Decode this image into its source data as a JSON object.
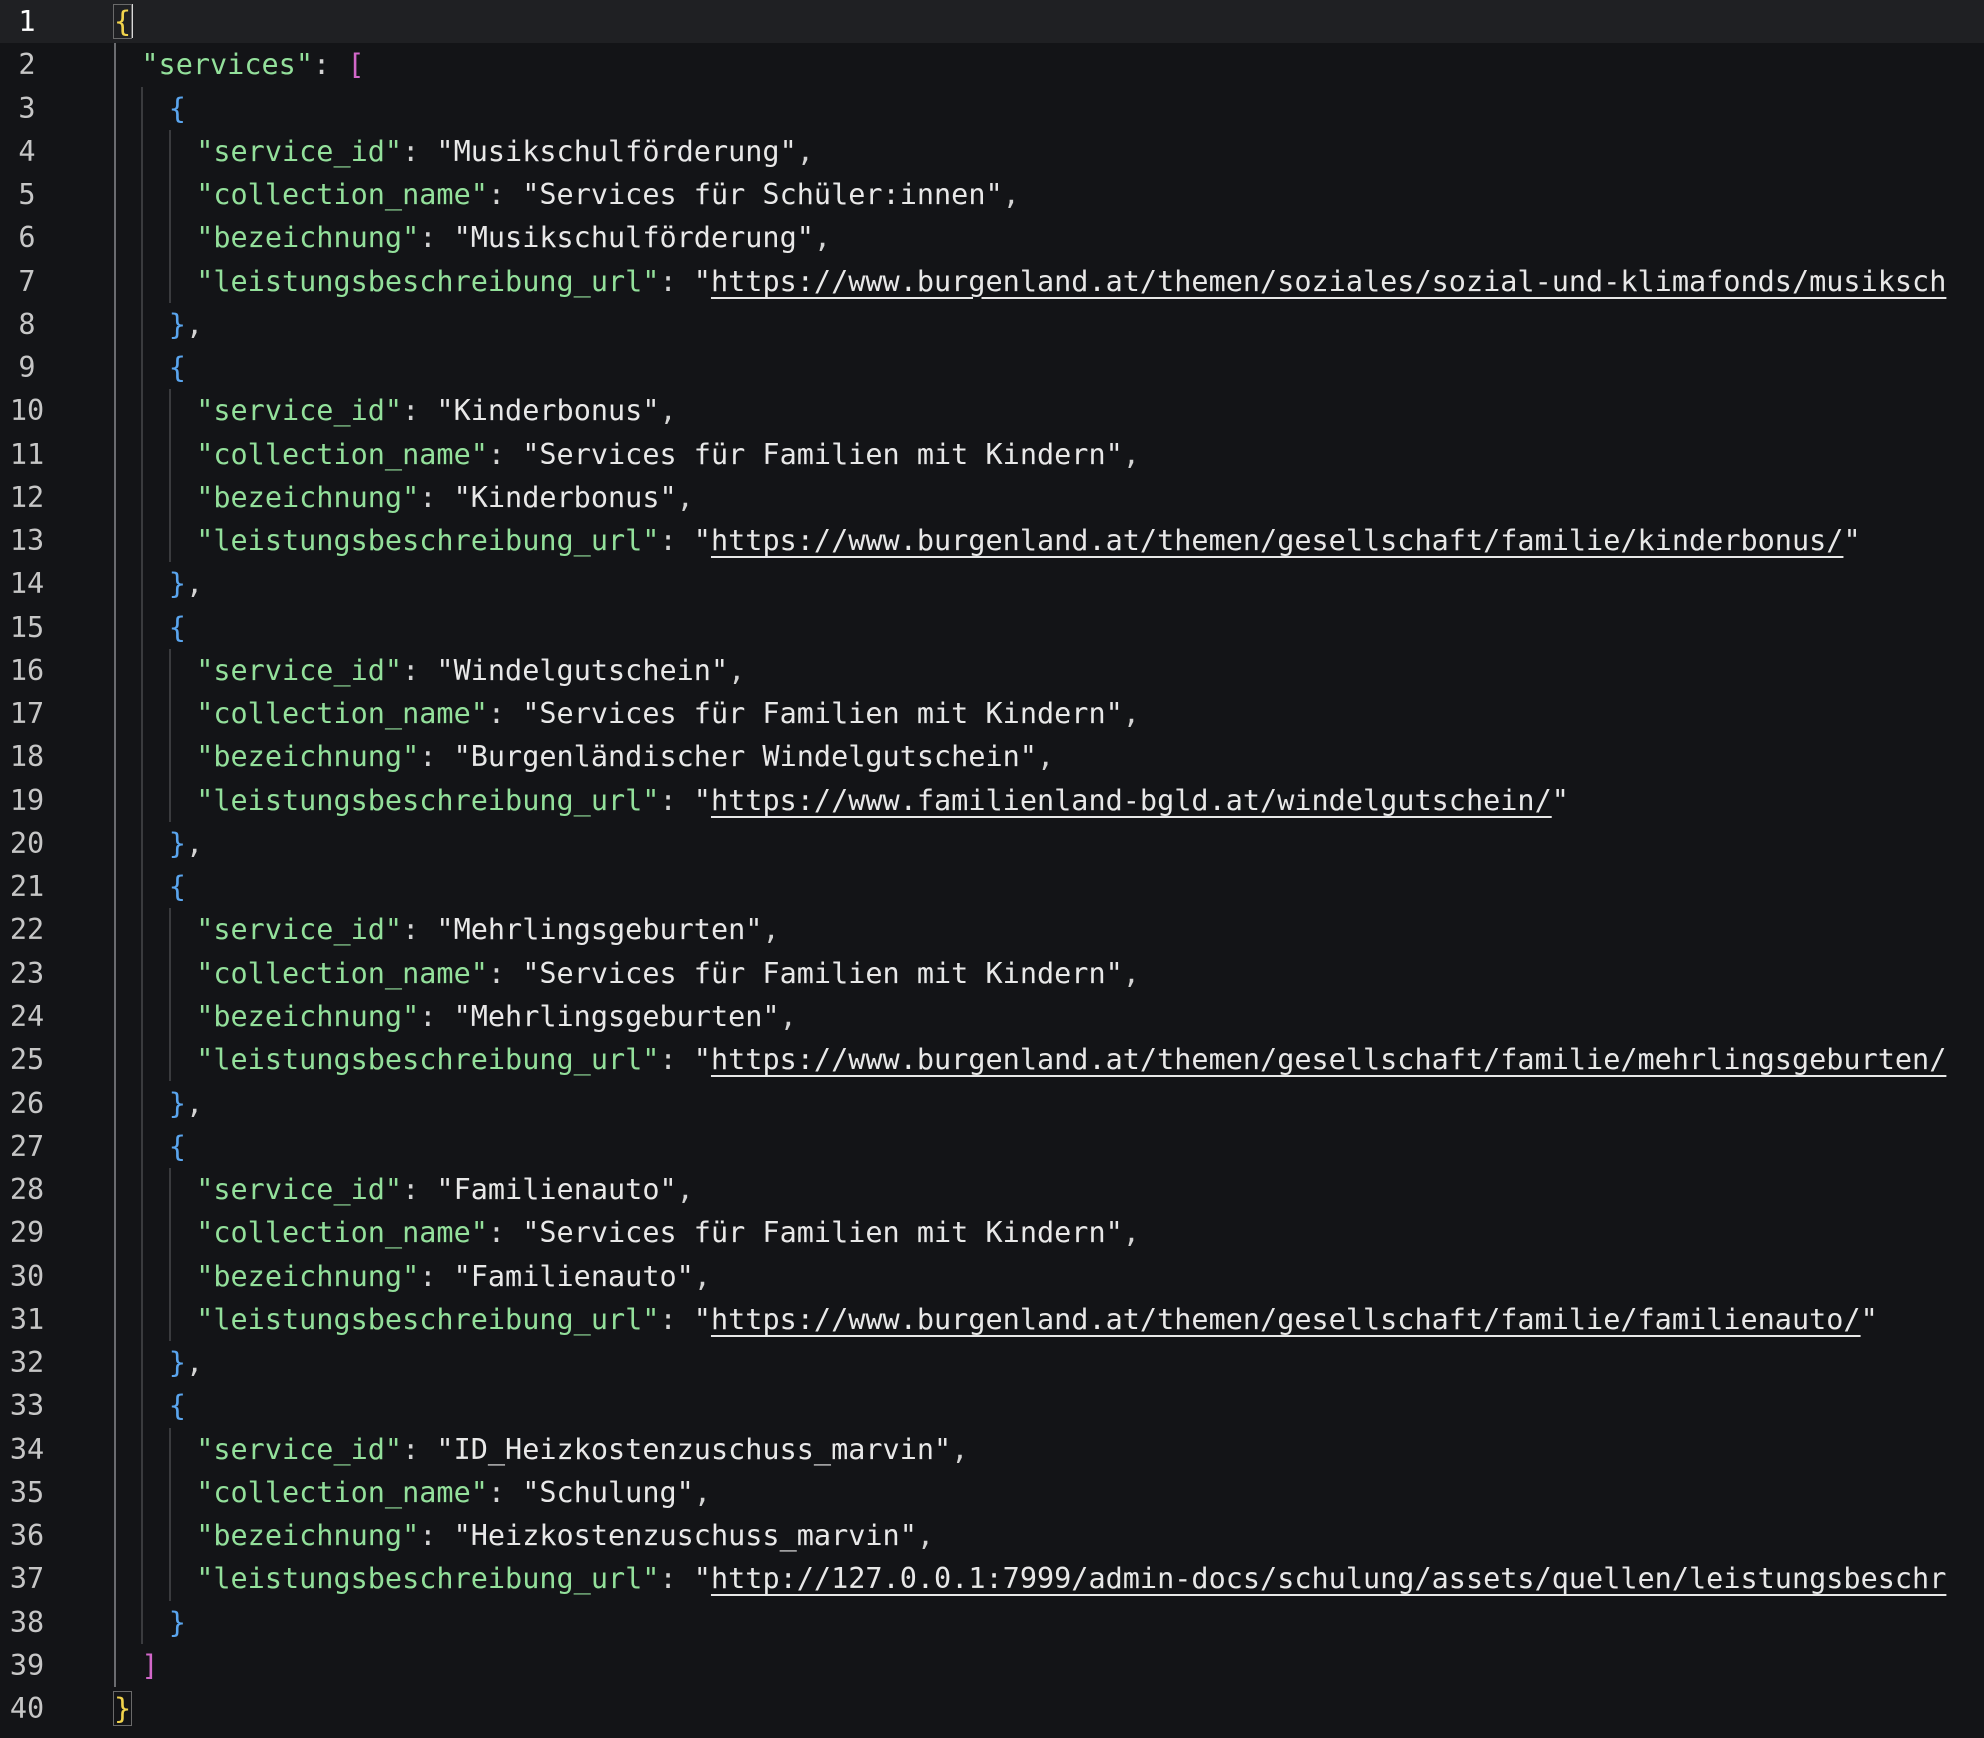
{
  "editor": {
    "language": "json",
    "cursor": {
      "line": 1,
      "column": 2
    },
    "lines": [
      {
        "n": "1",
        "indent": 0,
        "tokens": [
          {
            "t": "{",
            "c": "b1"
          }
        ]
      },
      {
        "n": "2",
        "indent": 1,
        "tokens": [
          {
            "t": "\"services\"",
            "c": "key"
          },
          {
            "t": ": ",
            "c": "punc"
          },
          {
            "t": "[",
            "c": "b2"
          }
        ]
      },
      {
        "n": "3",
        "indent": 2,
        "tokens": [
          {
            "t": "{",
            "c": "b3"
          }
        ]
      },
      {
        "n": "4",
        "indent": 3,
        "tokens": [
          {
            "t": "\"service_id\"",
            "c": "key"
          },
          {
            "t": ": ",
            "c": "punc"
          },
          {
            "t": "\"Musikschulförderung\"",
            "c": "str"
          },
          {
            "t": ",",
            "c": "punc"
          }
        ]
      },
      {
        "n": "5",
        "indent": 3,
        "tokens": [
          {
            "t": "\"collection_name\"",
            "c": "key"
          },
          {
            "t": ": ",
            "c": "punc"
          },
          {
            "t": "\"Services für Schüler:innen\"",
            "c": "str"
          },
          {
            "t": ",",
            "c": "punc"
          }
        ]
      },
      {
        "n": "6",
        "indent": 3,
        "tokens": [
          {
            "t": "\"bezeichnung\"",
            "c": "key"
          },
          {
            "t": ": ",
            "c": "punc"
          },
          {
            "t": "\"Musikschulförderung\"",
            "c": "str"
          },
          {
            "t": ",",
            "c": "punc"
          }
        ]
      },
      {
        "n": "7",
        "indent": 3,
        "tokens": [
          {
            "t": "\"leistungsbeschreibung_url\"",
            "c": "key"
          },
          {
            "t": ": ",
            "c": "punc"
          },
          {
            "t": "\"",
            "c": "str"
          },
          {
            "t": "https://www.burgenland.at/themen/soziales/sozial-und-klimafonds/musiksch",
            "c": "url"
          }
        ]
      },
      {
        "n": "8",
        "indent": 2,
        "tokens": [
          {
            "t": "}",
            "c": "b3"
          },
          {
            "t": ",",
            "c": "punc"
          }
        ]
      },
      {
        "n": "9",
        "indent": 2,
        "tokens": [
          {
            "t": "{",
            "c": "b3"
          }
        ]
      },
      {
        "n": "10",
        "indent": 3,
        "tokens": [
          {
            "t": "\"service_id\"",
            "c": "key"
          },
          {
            "t": ": ",
            "c": "punc"
          },
          {
            "t": "\"Kinderbonus\"",
            "c": "str"
          },
          {
            "t": ",",
            "c": "punc"
          }
        ]
      },
      {
        "n": "11",
        "indent": 3,
        "tokens": [
          {
            "t": "\"collection_name\"",
            "c": "key"
          },
          {
            "t": ": ",
            "c": "punc"
          },
          {
            "t": "\"Services für Familien mit Kindern\"",
            "c": "str"
          },
          {
            "t": ",",
            "c": "punc"
          }
        ]
      },
      {
        "n": "12",
        "indent": 3,
        "tokens": [
          {
            "t": "\"bezeichnung\"",
            "c": "key"
          },
          {
            "t": ": ",
            "c": "punc"
          },
          {
            "t": "\"Kinderbonus\"",
            "c": "str"
          },
          {
            "t": ",",
            "c": "punc"
          }
        ]
      },
      {
        "n": "13",
        "indent": 3,
        "tokens": [
          {
            "t": "\"leistungsbeschreibung_url\"",
            "c": "key"
          },
          {
            "t": ": ",
            "c": "punc"
          },
          {
            "t": "\"",
            "c": "str"
          },
          {
            "t": "https://www.burgenland.at/themen/gesellschaft/familie/kinderbonus/",
            "c": "url"
          },
          {
            "t": "\"",
            "c": "str"
          }
        ]
      },
      {
        "n": "14",
        "indent": 2,
        "tokens": [
          {
            "t": "}",
            "c": "b3"
          },
          {
            "t": ",",
            "c": "punc"
          }
        ]
      },
      {
        "n": "15",
        "indent": 2,
        "tokens": [
          {
            "t": "{",
            "c": "b3"
          }
        ]
      },
      {
        "n": "16",
        "indent": 3,
        "tokens": [
          {
            "t": "\"service_id\"",
            "c": "key"
          },
          {
            "t": ": ",
            "c": "punc"
          },
          {
            "t": "\"Windelgutschein\"",
            "c": "str"
          },
          {
            "t": ",",
            "c": "punc"
          }
        ]
      },
      {
        "n": "17",
        "indent": 3,
        "tokens": [
          {
            "t": "\"collection_name\"",
            "c": "key"
          },
          {
            "t": ": ",
            "c": "punc"
          },
          {
            "t": "\"Services für Familien mit Kindern\"",
            "c": "str"
          },
          {
            "t": ",",
            "c": "punc"
          }
        ]
      },
      {
        "n": "18",
        "indent": 3,
        "tokens": [
          {
            "t": "\"bezeichnung\"",
            "c": "key"
          },
          {
            "t": ": ",
            "c": "punc"
          },
          {
            "t": "\"Burgenländischer Windelgutschein\"",
            "c": "str"
          },
          {
            "t": ",",
            "c": "punc"
          }
        ]
      },
      {
        "n": "19",
        "indent": 3,
        "tokens": [
          {
            "t": "\"leistungsbeschreibung_url\"",
            "c": "key"
          },
          {
            "t": ": ",
            "c": "punc"
          },
          {
            "t": "\"",
            "c": "str"
          },
          {
            "t": "https://www.familienland-bgld.at/windelgutschein/",
            "c": "url"
          },
          {
            "t": "\"",
            "c": "str"
          }
        ]
      },
      {
        "n": "20",
        "indent": 2,
        "tokens": [
          {
            "t": "}",
            "c": "b3"
          },
          {
            "t": ",",
            "c": "punc"
          }
        ]
      },
      {
        "n": "21",
        "indent": 2,
        "tokens": [
          {
            "t": "{",
            "c": "b3"
          }
        ]
      },
      {
        "n": "22",
        "indent": 3,
        "tokens": [
          {
            "t": "\"service_id\"",
            "c": "key"
          },
          {
            "t": ": ",
            "c": "punc"
          },
          {
            "t": "\"Mehrlingsgeburten\"",
            "c": "str"
          },
          {
            "t": ",",
            "c": "punc"
          }
        ]
      },
      {
        "n": "23",
        "indent": 3,
        "tokens": [
          {
            "t": "\"collection_name\"",
            "c": "key"
          },
          {
            "t": ": ",
            "c": "punc"
          },
          {
            "t": "\"Services für Familien mit Kindern\"",
            "c": "str"
          },
          {
            "t": ",",
            "c": "punc"
          }
        ]
      },
      {
        "n": "24",
        "indent": 3,
        "tokens": [
          {
            "t": "\"bezeichnung\"",
            "c": "key"
          },
          {
            "t": ": ",
            "c": "punc"
          },
          {
            "t": "\"Mehrlingsgeburten\"",
            "c": "str"
          },
          {
            "t": ",",
            "c": "punc"
          }
        ]
      },
      {
        "n": "25",
        "indent": 3,
        "tokens": [
          {
            "t": "\"leistungsbeschreibung_url\"",
            "c": "key"
          },
          {
            "t": ": ",
            "c": "punc"
          },
          {
            "t": "\"",
            "c": "str"
          },
          {
            "t": "https://www.burgenland.at/themen/gesellschaft/familie/mehrlingsgeburten/",
            "c": "url"
          }
        ]
      },
      {
        "n": "26",
        "indent": 2,
        "tokens": [
          {
            "t": "}",
            "c": "b3"
          },
          {
            "t": ",",
            "c": "punc"
          }
        ]
      },
      {
        "n": "27",
        "indent": 2,
        "tokens": [
          {
            "t": "{",
            "c": "b3"
          }
        ]
      },
      {
        "n": "28",
        "indent": 3,
        "tokens": [
          {
            "t": "\"service_id\"",
            "c": "key"
          },
          {
            "t": ": ",
            "c": "punc"
          },
          {
            "t": "\"Familienauto\"",
            "c": "str"
          },
          {
            "t": ",",
            "c": "punc"
          }
        ]
      },
      {
        "n": "29",
        "indent": 3,
        "tokens": [
          {
            "t": "\"collection_name\"",
            "c": "key"
          },
          {
            "t": ": ",
            "c": "punc"
          },
          {
            "t": "\"Services für Familien mit Kindern\"",
            "c": "str"
          },
          {
            "t": ",",
            "c": "punc"
          }
        ]
      },
      {
        "n": "30",
        "indent": 3,
        "tokens": [
          {
            "t": "\"bezeichnung\"",
            "c": "key"
          },
          {
            "t": ": ",
            "c": "punc"
          },
          {
            "t": "\"Familienauto\"",
            "c": "str"
          },
          {
            "t": ",",
            "c": "punc"
          }
        ]
      },
      {
        "n": "31",
        "indent": 3,
        "tokens": [
          {
            "t": "\"leistungsbeschreibung_url\"",
            "c": "key"
          },
          {
            "t": ": ",
            "c": "punc"
          },
          {
            "t": "\"",
            "c": "str"
          },
          {
            "t": "https://www.burgenland.at/themen/gesellschaft/familie/familienauto/",
            "c": "url"
          },
          {
            "t": "\"",
            "c": "str"
          }
        ]
      },
      {
        "n": "32",
        "indent": 2,
        "tokens": [
          {
            "t": "}",
            "c": "b3"
          },
          {
            "t": ",",
            "c": "punc"
          }
        ]
      },
      {
        "n": "33",
        "indent": 2,
        "tokens": [
          {
            "t": "{",
            "c": "b3"
          }
        ]
      },
      {
        "n": "34",
        "indent": 3,
        "tokens": [
          {
            "t": "\"service_id\"",
            "c": "key"
          },
          {
            "t": ": ",
            "c": "punc"
          },
          {
            "t": "\"ID_Heizkostenzuschuss_marvin\"",
            "c": "str"
          },
          {
            "t": ",",
            "c": "punc"
          }
        ]
      },
      {
        "n": "35",
        "indent": 3,
        "tokens": [
          {
            "t": "\"collection_name\"",
            "c": "key"
          },
          {
            "t": ": ",
            "c": "punc"
          },
          {
            "t": "\"Schulung\"",
            "c": "str"
          },
          {
            "t": ",",
            "c": "punc"
          }
        ]
      },
      {
        "n": "36",
        "indent": 3,
        "tokens": [
          {
            "t": "\"bezeichnung\"",
            "c": "key"
          },
          {
            "t": ": ",
            "c": "punc"
          },
          {
            "t": "\"Heizkostenzuschuss_marvin\"",
            "c": "str"
          },
          {
            "t": ",",
            "c": "punc"
          }
        ]
      },
      {
        "n": "37",
        "indent": 3,
        "tokens": [
          {
            "t": "\"leistungsbeschreibung_url\"",
            "c": "key"
          },
          {
            "t": ": ",
            "c": "punc"
          },
          {
            "t": "\"",
            "c": "str"
          },
          {
            "t": "http://127.0.0.1:7999/admin-docs/schulung/assets/quellen/leistungsbeschr",
            "c": "url"
          }
        ]
      },
      {
        "n": "38",
        "indent": 2,
        "tokens": [
          {
            "t": "}",
            "c": "b3"
          }
        ]
      },
      {
        "n": "39",
        "indent": 1,
        "tokens": [
          {
            "t": "]",
            "c": "b2"
          }
        ]
      },
      {
        "n": "40",
        "indent": 0,
        "tokens": [
          {
            "t": "}",
            "c": "b1"
          }
        ]
      }
    ]
  },
  "colors": {
    "background": "#131417",
    "current_line": "#1f2023",
    "key": "#93e09b",
    "string": "#e8e8e8",
    "bracket_level_1": "#f1d34c",
    "bracket_level_2": "#d267c9",
    "bracket_level_3": "#5aa5ee",
    "line_number": "#c6c6c6"
  }
}
